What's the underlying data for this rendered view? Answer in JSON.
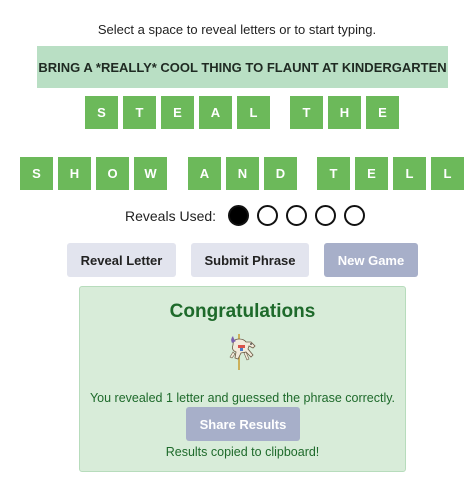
{
  "instructions": "Select a space to reveal letters or to start typing.",
  "clue": "BRING A *REALLY* COOL THING TO FLAUNT AT KINDERGARTEN",
  "phrase": {
    "row1": [
      [
        "S",
        "T",
        "E",
        "A",
        "L"
      ],
      [
        "T",
        "H",
        "E"
      ]
    ],
    "row2": [
      [
        "S",
        "H",
        "O",
        "W"
      ],
      [
        "A",
        "N",
        "D"
      ],
      [
        "T",
        "E",
        "L",
        "L"
      ]
    ]
  },
  "reveals": {
    "label": "Reveals Used:",
    "used": 1,
    "total": 5
  },
  "buttons": {
    "reveal_letter": "Reveal Letter",
    "submit_phrase": "Submit Phrase",
    "new_game": "New Game"
  },
  "result": {
    "title": "Congratulations",
    "icon": "carousel-horse-icon",
    "message": "You revealed 1 letter and guessed the phrase correctly.",
    "share_button": "Share Results",
    "copied_message": "Results copied to clipboard!"
  },
  "colors": {
    "tile": "#6cb95a",
    "clue_bg": "#b9dfc4",
    "result_bg": "#d8ecd9",
    "result_text": "#1e6a2b",
    "secondary_button": "#e2e4ee",
    "primary_button": "#a7afc9"
  }
}
